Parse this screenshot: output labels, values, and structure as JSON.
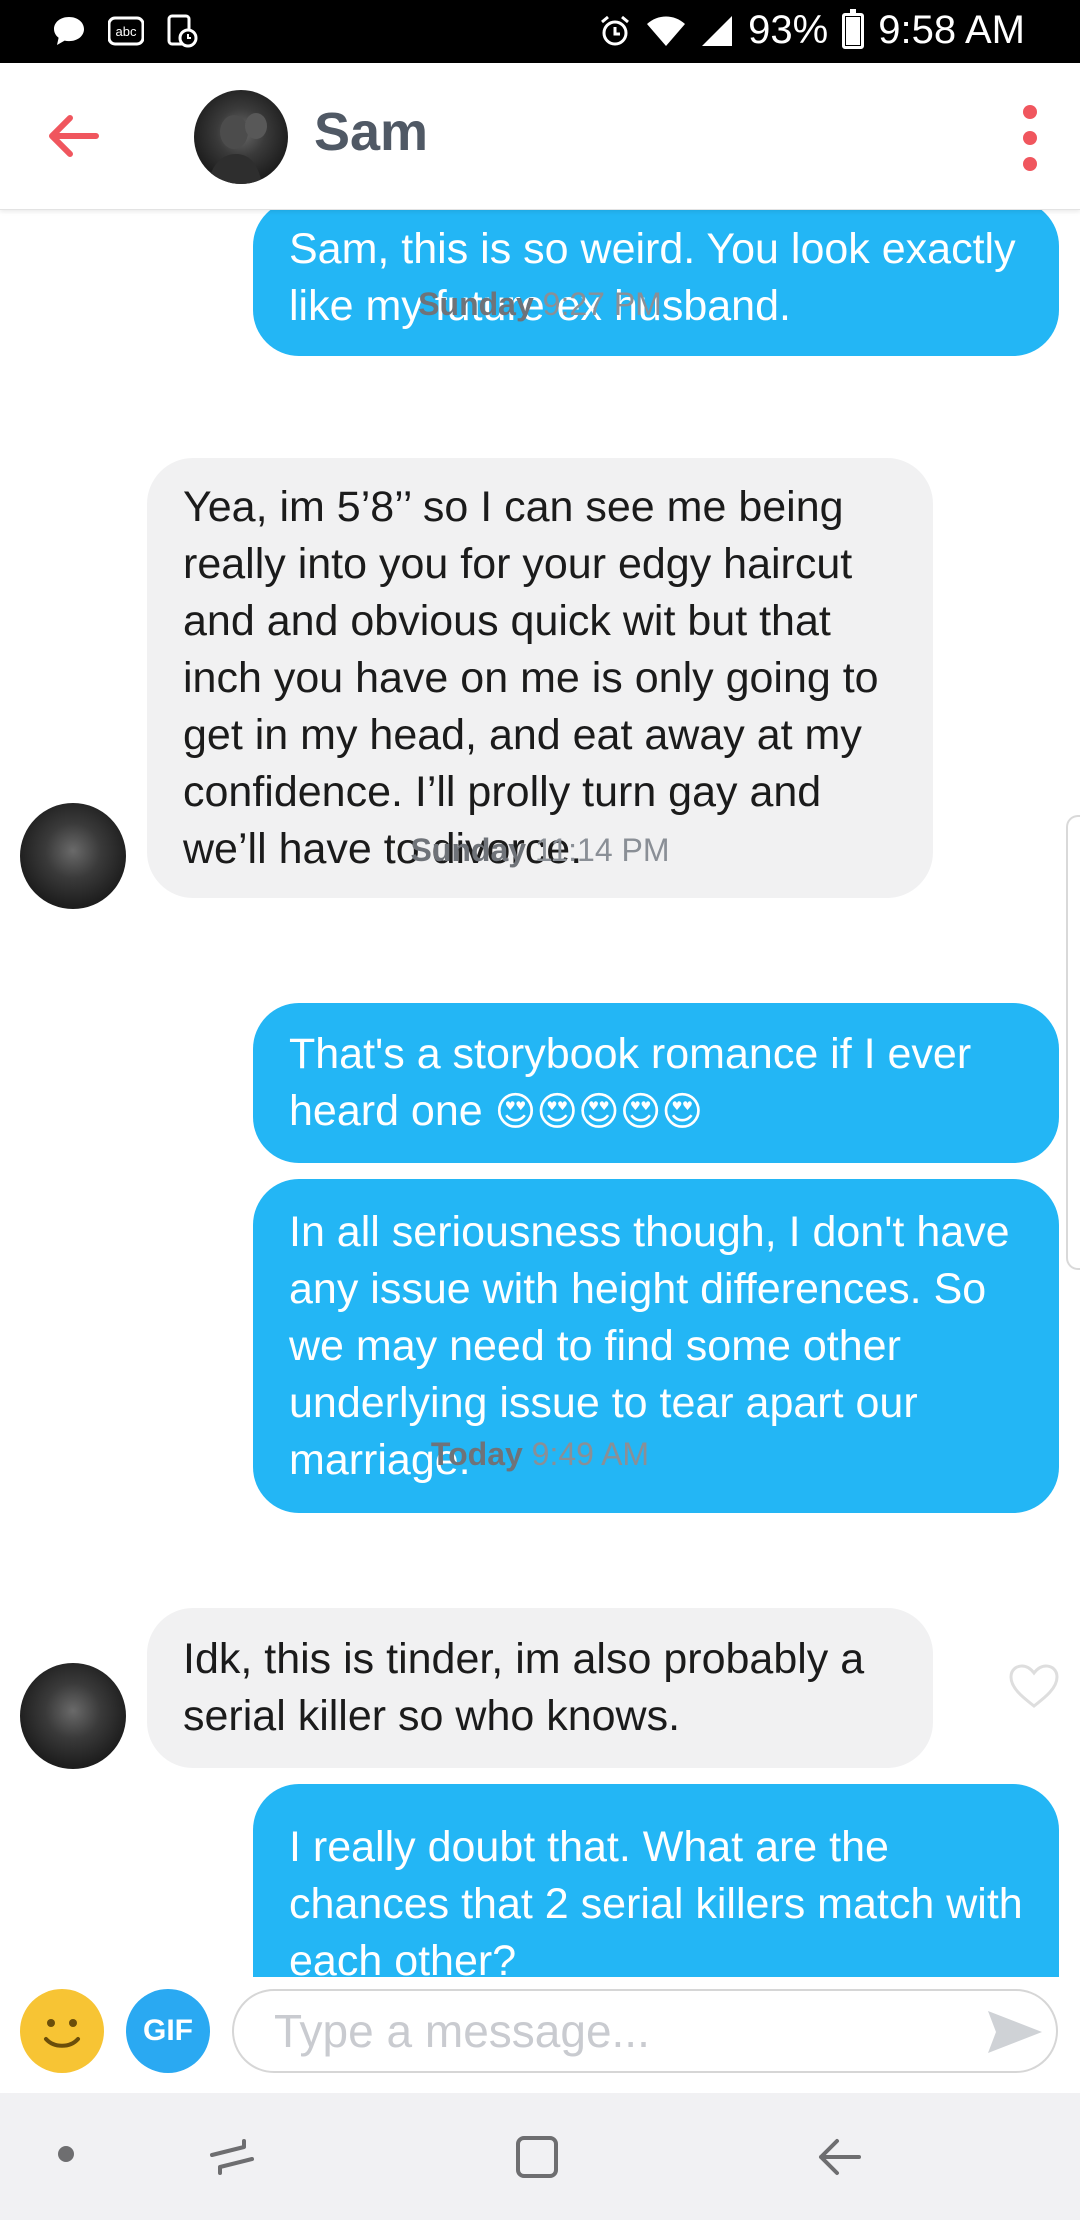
{
  "status_bar": {
    "battery": "93%",
    "time": "9:58 AM",
    "icons": [
      "chat-icon",
      "abc-icon",
      "screenshot-icon",
      "alarm-icon",
      "wifi-icon",
      "signal-icon",
      "battery-icon"
    ],
    "battery_level": 0.93
  },
  "header": {
    "contact_name": "Sam",
    "icons": [
      "back-arrow-icon",
      "avatar",
      "more-vertical-icon"
    ],
    "accent_color": "#f0565e"
  },
  "messages": [
    {
      "side": "out",
      "text": "Sam, this is so weird. You look exactly like my future ex husband."
    },
    {
      "stamp_day": "Sunday",
      "stamp_time": "9:27 PM"
    },
    {
      "side": "in",
      "text": "Yea, im 5’8’’ so I can see me being really into you for your edgy haircut and and obvious quick wit but that inch you have on me is only going to get in my head, and eat away at my confidence. I’ll prolly turn gay and we’ll have to divorce."
    },
    {
      "stamp_day": "Sunday",
      "stamp_time": "11:14 PM"
    },
    {
      "side": "out",
      "text": "That's a storybook romance if I ever heard one",
      "emoji": "😍😍😍😍😍"
    },
    {
      "side": "out",
      "text": "In all seriousness though, I don't have any issue with height differences. So we may need to find some other underlying issue to tear apart our marriage."
    },
    {
      "stamp_day": "Today",
      "stamp_time": "9:49 AM"
    },
    {
      "side": "in",
      "text": "Idk, this is tinder, im also probably a serial killer so who knows."
    },
    {
      "side": "out",
      "text": "I really doubt that. What are the chances that 2 serial killers match with each other?"
    }
  ],
  "composer": {
    "gif_label": "GIF",
    "placeholder": "Type a message...",
    "value": ""
  },
  "colors": {
    "outgoing_bubble": "#23b6f5",
    "incoming_bubble": "#f1f1f2",
    "emoji_button": "#f7c434",
    "gif_button": "#2aa9f2"
  }
}
